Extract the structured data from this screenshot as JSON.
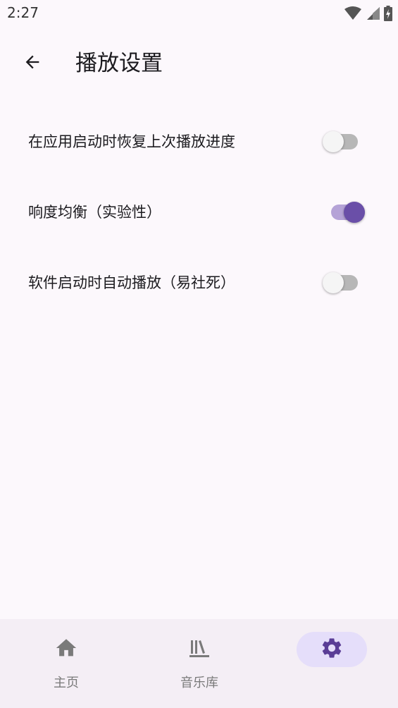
{
  "status_bar": {
    "time": "2:27",
    "icons": [
      "wifi-icon",
      "signal-icon",
      "battery-charging-icon"
    ]
  },
  "app_bar": {
    "back_icon": "arrow-back-icon",
    "title": "播放设置"
  },
  "settings": [
    {
      "label": "在应用启动时恢复上次播放进度",
      "enabled": false
    },
    {
      "label": "响度均衡（实验性）",
      "enabled": true
    },
    {
      "label": "软件启动时自动播放（易社死）",
      "enabled": false
    }
  ],
  "bottom_nav": {
    "items": [
      {
        "label": "主页",
        "icon": "home-icon",
        "active": false
      },
      {
        "label": "音乐库",
        "icon": "library-icon",
        "active": false
      },
      {
        "label": "",
        "icon": "gear-icon",
        "active": true
      }
    ]
  },
  "colors": {
    "background": "#fcf8fc",
    "accent": "#6a4fa8",
    "accent_track": "#b5a3d7",
    "nav_background": "#f4eef5",
    "nav_indicator": "#e5defa"
  }
}
